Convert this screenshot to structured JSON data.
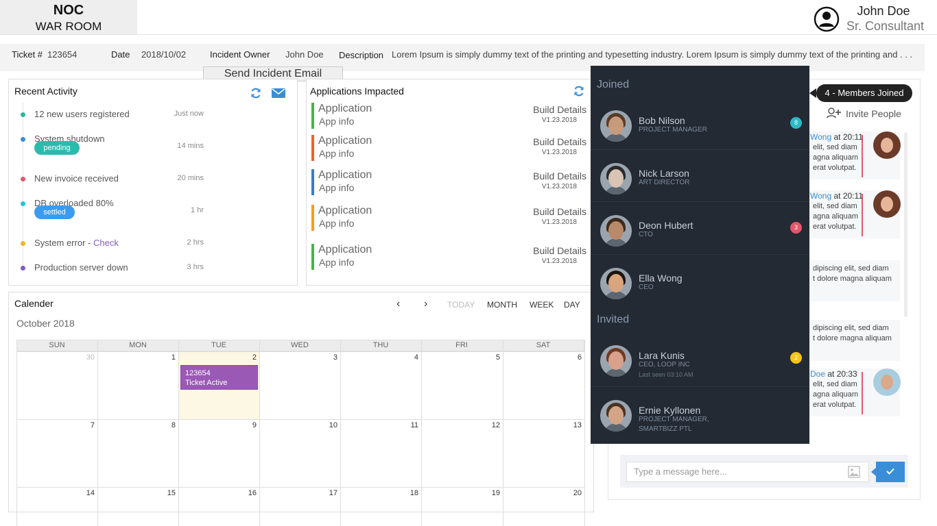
{
  "brand": {
    "line1": "NOC",
    "line2": "WAR ROOM"
  },
  "user": {
    "name": "John Doe",
    "role": "Sr. Consultant"
  },
  "ticket": {
    "ticket_label": "Ticket #",
    "ticket_value": "123654",
    "date_label": "Date",
    "date_value": "2018/10/02",
    "owner_label": "Incident Owner",
    "owner_value": "John Doe",
    "description_label": "Description",
    "description_value": "Lorem Ipsum is simply dummy text of the printing and typesetting industry. Lorem  Ipsum is simply dummy text of the printing and . . ."
  },
  "email_button": "Send Incident Email",
  "recent_activity": {
    "title": "Recent Activity",
    "items": [
      {
        "text": "12 new users registered",
        "time": "Just now",
        "color": "#26b99a"
      },
      {
        "text": "System shutdown",
        "time": "14 mins",
        "badge": "pending",
        "badge_color": "#2bbbad",
        "color": "#3a8ed8"
      },
      {
        "text": "New invoice received",
        "time": "20 mins",
        "color": "#e5566b"
      },
      {
        "text": "DB overloaded 80%",
        "time": "1 hr",
        "badge": "settled",
        "badge_color": "#3a9cf0",
        "color": "#1fc6d6"
      },
      {
        "text": "System error - ",
        "link": "Check",
        "time": "2 hrs",
        "color": "#f4b324"
      },
      {
        "text": "Production server down",
        "time": "3 hrs",
        "color": "#7f5cc4"
      }
    ]
  },
  "apps": {
    "title": "Applications Impacted",
    "items": [
      {
        "name": "Application",
        "info": "App info",
        "build": "Build Details",
        "version": "V1.23.2018",
        "color": "#4cb050"
      },
      {
        "name": "Application",
        "info": "App info",
        "build": "Build Details",
        "version": "V1.23.2018",
        "color": "#f0612d"
      },
      {
        "name": "Application",
        "info": "App info",
        "build": "Build Details",
        "version": "V1.23.2018",
        "color": "#3a7cc4"
      },
      {
        "name": "Application",
        "info": "App info",
        "build": "Build Details",
        "version": "V1.23.2018",
        "color": "#f39c24"
      },
      {
        "name": "Application",
        "info": "App info",
        "build": "Build Details",
        "version": "V1.23.2018",
        "color": "#4cb050"
      }
    ]
  },
  "calendar": {
    "title": "Calender",
    "month": "October 2018",
    "nav": {
      "prev": "‹",
      "next": "›",
      "today": "TODAY",
      "month": "MONTH",
      "week": "WEEK",
      "day": "DAY"
    },
    "days": [
      "SUN",
      "MON",
      "TUE",
      "WED",
      "THU",
      "FRI",
      "SAT"
    ],
    "weeks": [
      [
        "30",
        "1",
        "2",
        "3",
        "4",
        "5",
        "6"
      ],
      [
        "7",
        "8",
        "9",
        "10",
        "11",
        "12",
        "13"
      ],
      [
        "14",
        "15",
        "16",
        "17",
        "18",
        "19",
        "20"
      ]
    ],
    "event": {
      "line1": "123654",
      "line2": "Ticket Active"
    }
  },
  "chat": {
    "members_joined": "4 - Members Joined",
    "invite": "Invite People",
    "messages": [
      {
        "name_frag": "Wong",
        "time": " at 20:11",
        "lines": [
          "elit, sed diam",
          "agna aliquam",
          "erat volutpat."
        ]
      },
      {
        "name_frag": "Wong",
        "time": " at 20:11",
        "lines": [
          "elit, sed diam",
          "agna aliquam",
          "erat volutpat."
        ]
      },
      {
        "lines": [
          "dipiscing elit, sed diam",
          "t dolore magna aliquam"
        ]
      },
      {
        "lines": [
          "dipiscing elit, sed diam",
          "t dolore magna aliquam"
        ]
      },
      {
        "name_frag": "Doe",
        "time": " at 20:33",
        "lines": [
          "elit, sed diam",
          "agna aliquam",
          "erat volutpat."
        ]
      }
    ],
    "input_placeholder": "Type a message here..."
  },
  "members": {
    "joined_label": "Joined",
    "invited_label": "Invited",
    "joined": [
      {
        "name": "Bob Nilson",
        "role": "PROJECT MANAGER",
        "badge": "8",
        "badge_color": "#2bbbc8",
        "skin": "#c89a7c",
        "hair": "#5a3b25"
      },
      {
        "name": "Nick Larson",
        "role": "ART DIRECTOR",
        "skin": "#d8c4b4",
        "hair": "#2a2a2a"
      },
      {
        "name": "Deon Hubert",
        "role": "CTO",
        "badge": "3",
        "badge_color": "#e5566b",
        "skin": "#b88a6a",
        "hair": "#3e2a1a"
      },
      {
        "name": "Ella Wong",
        "role": "CEO",
        "skin": "#d9a57e",
        "hair": "#1c130e"
      }
    ],
    "invited": [
      {
        "name": "Lara Kunis",
        "role": "CEO, LOOP INC",
        "extra": "Last seen 03:10 AM",
        "badge": "2",
        "badge_color": "#f5c518",
        "skin": "#d9a08a",
        "hair": "#6e3a25"
      },
      {
        "name": "Ernie Kyllonen",
        "role": "PROJECT MANAGER,",
        "extra": "SMARTBIZZ PTL",
        "skin": "#d4a486",
        "hair": "#4a3222"
      }
    ]
  }
}
